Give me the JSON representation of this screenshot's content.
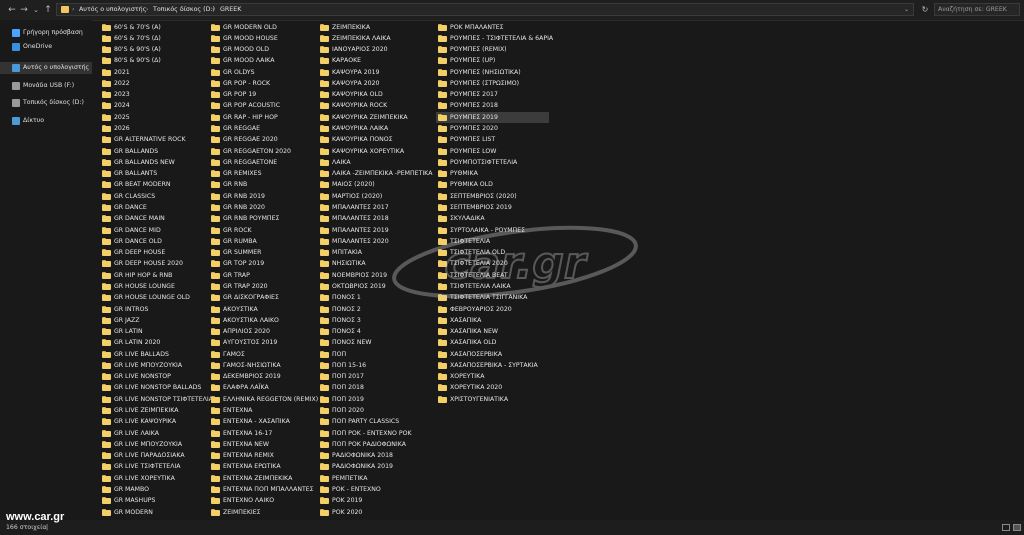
{
  "toolbar": {
    "back": "←",
    "forward": "→",
    "recent": "⌄",
    "up": "↑",
    "breadcrumbs": [
      "Αυτός ο υπολογιστής",
      "Τοπικός δίσκος (D:)",
      "GREEK"
    ],
    "separator": "›",
    "dropdown": "⌄",
    "refresh": "↻",
    "search_placeholder": "Αναζήτηση σε: GREEK"
  },
  "nav": [
    {
      "label": "Γρήγορη πρόσβαση",
      "icon": "star-icon",
      "color": "#4aa3ff",
      "selected": false
    },
    {
      "label": "OneDrive",
      "icon": "cloud-icon",
      "color": "#3c8fe0",
      "selected": false
    },
    {
      "label": "Αυτός ο υπολογιστής",
      "icon": "computer-icon",
      "color": "#4a9ad8",
      "selected": true
    },
    {
      "label": "Μονάδα USB (F:)",
      "icon": "usb-drive-icon",
      "color": "#9a9a9a",
      "selected": false
    },
    {
      "label": "Τοπικός δίσκος (D:)",
      "icon": "drive-icon",
      "color": "#9a9a9a",
      "selected": false
    },
    {
      "label": "Δίκτυο",
      "icon": "network-icon",
      "color": "#4a9ad8",
      "selected": false
    }
  ],
  "columns": [
    [
      "60'S & 70'S (A)",
      "60'S & 70'S (Δ)",
      "80'S & 90'S (A)",
      "80'S & 90'S (Δ)",
      "2021",
      "2022",
      "2023",
      "2024",
      "2025",
      "2026",
      "GR ALTERNATIVE ROCK",
      "GR BALLANDS",
      "GR BALLANDS NEW",
      "GR BALLANTS",
      "GR BEAT MODERN",
      "GR CLASSICS",
      "GR DANCE",
      "GR DANCE MAIN",
      "GR DANCE MID",
      "GR DANCE OLD",
      "GR DEEP HOUSE",
      "GR DEEP HOUSE 2020",
      "GR HIP HOP & RNB",
      "GR HOUSE LOUNGE",
      "GR HOUSE LOUNGE OLD",
      "GR INTROS",
      "GR JAZZ",
      "GR LATIN",
      "GR LATIN 2020",
      "GR LIVE BALLADS",
      "GR LIVE ΜΠΟΥΖΟΥΚΙΑ",
      "GR LIVE NONSTOP",
      "GR LIVE NONSTOP BALLADS",
      "GR LIVE NONSTOP ΤΣΙΦΤΕΤΕΛΙΑ",
      "GR LIVE ΖΕΙΜΠΕΚΙΚΑ",
      "GR LIVE ΚΑΨΟΥΡΙΚΑ",
      "GR LIVE ΛΑΙΚΑ",
      "GR LIVE ΜΠΟΥΖΟΥΚΙΑ",
      "GR LIVE ΠΑΡΑΔΟΣΙΑΚΑ",
      "GR LIVE ΤΣΙΦΤΕΤΕΛΙΑ",
      "GR LIVE ΧΟΡΕΥΤΙΚΑ",
      "GR MAMBO",
      "GR MASHUPS",
      "GR MODERN"
    ],
    [
      "GR MODERN OLD",
      "GR MOOD HOUSE",
      "GR MOOD OLD",
      "GR MOOD ΛΑΙΚΑ",
      "GR OLDYS",
      "GR POP - ROCK",
      "GR POP 19",
      "GR POP ACOUSTIC",
      "GR RAP - HIP HOP",
      "GR REGGAE",
      "GR REGGAE 2020",
      "GR REGGAETON 2020",
      "GR REGGAETONE",
      "GR REMIXES",
      "GR RNB",
      "GR RNB 2019",
      "GR RNB 2020",
      "GR RNB ΡΟΥΜΠΕΣ",
      "GR ROCK",
      "GR RUMBA",
      "GR SUMMER",
      "GR TOP 2019",
      "GR TRAP",
      "GR TRAP 2020",
      "GR ΔΙΣΚΟΓΡΑΦΙΕΣ",
      "ΑΚΟΥΣΤΙΚΑ",
      "ΑΚΟΥΣΤΙΚΑ ΛΑΙΚΟ",
      "ΑΠΡΙΛΙΟΣ 2020",
      "ΑΥΓΟΥΣΤΟΣ 2019",
      "ΓΑΜΟΣ",
      "ΓΑΜΟΣ-ΝΗΣΙΩΤΙΚΑ",
      "ΔΕΚΕΜΒΡΙΟΣ 2019",
      "ΕΛΑΦΡΑ ΛΑΪΚΑ",
      "ΕΛΛΗΝΙΚΑ REGGETON (REMIX)",
      "ΕΝΤΕΧΝΑ",
      "ΕΝΤΕΧΝΑ - ΧΑΣΑΠΙΚΑ",
      "ΕΝΤΕΧΝΑ 16-17",
      "ΕΝΤΕΧΝΑ NEW",
      "ΕΝΤΕΧΝΑ REMIX",
      "ΕΝΤΕΧΝΑ ΕΡΩΤΙΚΑ",
      "ΕΝΤΕΧΝΑ ΖΕΙΜΠΕΚΙΚΑ",
      "ΕΝΤΕΧΝΑ ΠΟΠ ΜΠΑΛΛΑΝΤΕΣ",
      "ΕΝΤΕΧΝΟ ΛΑΙΚΟ",
      "ΖΕΙΜΠΕΚΙΕΣ"
    ],
    [
      "ΖΕΙΜΠΕΚΙΚΑ",
      "ΖΕΙΜΠΕΚΙΚΑ ΛΑΙΚΑ",
      "ΙΑΝΟΥΑΡΙΟΣ 2020",
      "ΚΑΡΑΟΚΕ",
      "ΚΑΨΟΥΡΑ 2019",
      "ΚΑΨΟΥΡΑ 2020",
      "ΚΑΨΟΥΡΙΚΑ OLD",
      "ΚΑΨΟΥΡΙΚΑ ROCK",
      "ΚΑΨΟΥΡΙΚΑ ΖΕΙΜΠΕΚΙΚΑ",
      "ΚΑΨΟΥΡΙΚΑ ΛΑΙΚΑ",
      "ΚΑΨΟΥΡΙΚΑ ΠΟΝΟΣ",
      "ΚΑΨΟΥΡΙΚΑ ΧΟΡΕΥΤΙΚΑ",
      "ΛΑΙΚΑ",
      "ΛΑΙΚΑ -ΖΕΙΜΠΕΚΙΚΑ -ΡΕΜΠΕΤΙΚΑ",
      "ΜΑΙΟΣ (2020)",
      "ΜΑΡΤΙΟΣ (2020)",
      "ΜΠΑΛΑΝΤΕΣ 2017",
      "ΜΠΑΛΑΝΤΕΣ 2018",
      "ΜΠΑΛΑΝΤΕΣ 2019",
      "ΜΠΑΛΑΝΤΕΣ 2020",
      "ΜΠΙΤΑΚΙΑ",
      "ΝΗΣΙΩΤΙΚΑ",
      "ΝΟΕΜΒΡΙΟΣ 2019",
      "ΟΚΤΩΒΡΙΟΣ 2019",
      "ΠΟΝΟΣ 1",
      "ΠΟΝΟΣ 2",
      "ΠΟΝΟΣ 3",
      "ΠΟΝΟΣ 4",
      "ΠΟΝΟΣ NEW",
      "ΠΟΠ",
      "ΠΟΠ 15-16",
      "ΠΟΠ 2017",
      "ΠΟΠ 2018",
      "ΠΟΠ 2019",
      "ΠΟΠ 2020",
      "ΠΟΠ PARTY CLASSICS",
      "ΠΟΠ ΡΟΚ - ΕΝΤΕΧΝΟ ΡΟΚ",
      "ΠΟΠ ΡΟΚ ΡΑΔΙΟΦΩΝΙΚΑ",
      "ΡΑΔΙΟΦΩΝΙΚΑ 2018",
      "ΡΑΔΙΟΦΩΝΙΚΑ 2019",
      "ΡΕΜΠΕΤΙΚΑ",
      "ΡΟΚ - ΕΝΤΕΧΝΟ",
      "ΡΟΚ 2019",
      "ΡΟΚ 2020"
    ],
    [
      "ΡΟΚ ΜΠΑΛΑΝΤΕΣ",
      "ΡΟΥΜΠΕΣ - ΤΣΙΦΤΕΤΕΛΙΑ & 6ΑΡΙΑ",
      "ΡΟΥΜΠΕΣ (REMIX)",
      "ΡΟΥΜΠΕΣ (UP)",
      "ΡΟΥΜΠΕΣ (ΝΗΣΙΩΤΙΚΑ)",
      "ΡΟΥΜΠΕΣ (ΣΤΡΩΣΙΜΟ)",
      "ΡΟΥΜΠΕΣ 2017",
      "ΡΟΥΜΠΕΣ 2018",
      "ΡΟΥΜΠΕΣ 2019",
      "ΡΟΥΜΠΕΣ 2020",
      "ΡΟΥΜΠΕΣ LIST",
      "ΡΟΥΜΠΕΣ LOW",
      "ΡΟΥΜΠΟΤΣΙΦΤΕΤΕΛΙΑ",
      "ΡΥΘΜΙΚΑ",
      "ΡΥΘΜΙΚΑ OLD",
      "ΣΕΠΤΕΜΒΡΙΟΣ (2020)",
      "ΣΕΠΤΕΜΒΡΙΟΣ 2019",
      "ΣΚΥΛΑΔΙΚΑ",
      "ΣΥΡΤΟΛΑΙΚΑ - ΡΟΥΜΠΕΣ",
      "ΤΣΙΦΤΕΤΕΛΙΑ",
      "ΤΣΙΦΤΕΤΕΛΙΑ OLD",
      "ΤΣΙΦΤΕΤΕΛΙΑ 2020",
      "ΤΣΙΦΤΕΤΕΛΙΑ BEAT",
      "ΤΣΙΦΤΕΤΕΛΙΑ ΛΑΙΚΑ",
      "ΤΣΙΦΤΕΤΕΛΙΑ ΤΣΙΓΓΑΝΙΚΑ",
      "ΦΕΒΡΟΥΑΡΙΟΣ 2020",
      "ΧΑΣΑΠΙΚΑ",
      "ΧΑΣΑΠΙΚΑ NEW",
      "ΧΑΣΑΠΙΚΑ OLD",
      "ΧΑΣΑΠΟΣΕΡΒΙΚΑ",
      "ΧΑΣΑΠΟΣΕΡΒΙΚΑ - ΣΥΡΤΑΚΙΑ",
      "ΧΟΡΕΥΤΙΚΑ",
      "ΧΟΡΕΥΤΙΚΑ 2020",
      "ΧΡΙΣΤΟΥΓΕΝΙΑΤΙΚΑ"
    ]
  ],
  "selected_item": "ΡΟΥΜΠΕΣ 2019",
  "status": {
    "count": "166 στοιχεία",
    "sel_marker": "|"
  },
  "watermark_text": "car.gr",
  "site_mark": "www.car.gr",
  "colors": {
    "folder": "#f3cf67",
    "folder_tab": "#e0ac3a",
    "selection": "#3c3c3c",
    "background": "#191919"
  }
}
